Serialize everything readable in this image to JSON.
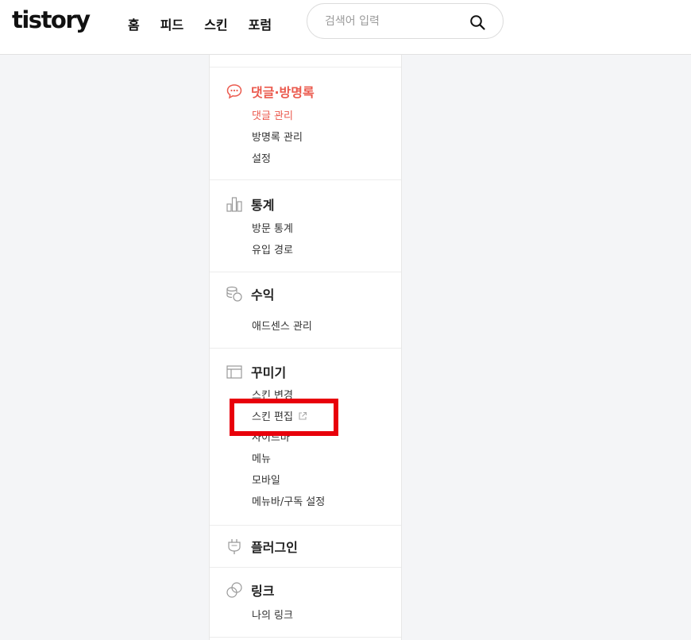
{
  "header": {
    "logo": "tistory",
    "nav": [
      "홈",
      "피드",
      "스킨",
      "포럼"
    ],
    "search": {
      "placeholder": "검색어 입력",
      "value": ""
    }
  },
  "sidebar": {
    "comments": {
      "title": "댓글·방명록",
      "icon": "speech-bubble-icon",
      "items": [
        "댓글 관리",
        "방명록 관리",
        "설정"
      ]
    },
    "stats": {
      "title": "통계",
      "icon": "bar-chart-icon",
      "items": [
        "방문 통계",
        "유입 경로"
      ]
    },
    "revenue": {
      "title": "수익",
      "icon": "coins-icon",
      "items": [
        "애드센스 관리"
      ]
    },
    "decorate": {
      "title": "꾸미기",
      "icon": "layout-icon",
      "items": [
        "스킨 변경",
        "스킨 편집",
        "사이드바",
        "메뉴",
        "모바일",
        "메뉴바/구독 설정"
      ]
    },
    "plugins": {
      "title": "플러그인",
      "icon": "plug-icon"
    },
    "links": {
      "title": "링크",
      "icon": "link-icon",
      "items": [
        "나의 링크"
      ]
    }
  },
  "colors": {
    "accent": "#eb5a4e",
    "highlight": "#e8000b"
  }
}
